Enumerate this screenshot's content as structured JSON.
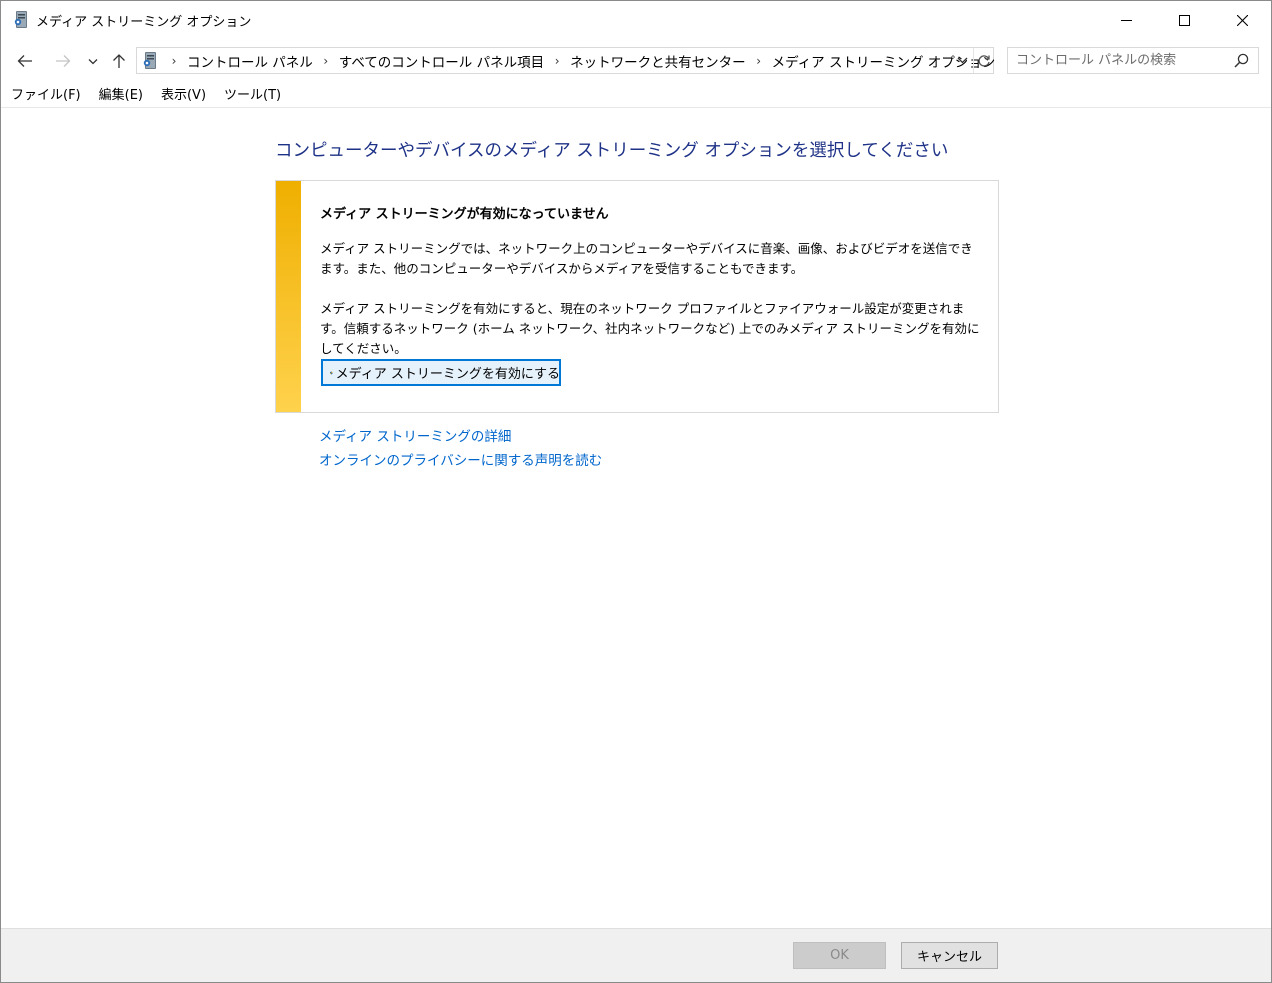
{
  "window": {
    "title": "メディア ストリーミング オプション"
  },
  "nav": {
    "breadcrumbs": [
      "コントロール パネル",
      "すべてのコントロール パネル項目",
      "ネットワークと共有センター",
      "メディア ストリーミング オプション"
    ],
    "search_placeholder": "コントロール パネルの検索"
  },
  "menu": {
    "items": [
      "ファイル(F)",
      "編集(E)",
      "表示(V)",
      "ツール(T)"
    ]
  },
  "main": {
    "title": "コンピューターやデバイスのメディア ストリーミング オプションを選択してください",
    "panel": {
      "heading": "メディア ストリーミングが有効になっていません",
      "p1": "メディア ストリーミングでは、ネットワーク上のコンピューターやデバイスに音楽、画像、およびビデオを送信できます。また、他のコンピューターやデバイスからメディアを受信することもできます。",
      "p2": "メディア ストリーミングを有効にすると、現在のネットワーク プロファイルとファイアウォール設定が変更されます。信頼するネットワーク (ホーム ネットワーク、社内ネットワークなど) 上でのみメディア ストリーミングを有効にしてください。",
      "enable_button": "メディア ストリーミングを有効にする"
    },
    "links": [
      "メディア ストリーミングの詳細",
      "オンラインのプライバシーに関する声明を読む"
    ]
  },
  "footer": {
    "ok_label": "OK",
    "cancel_label": "キャンセル"
  },
  "colors": {
    "title_blue": "#1e3287",
    "link_blue": "#0066cc",
    "stripe_top": "#efaf00",
    "stripe_bottom": "#ffd24d"
  },
  "icons": [
    "media-server-icon",
    "minimize-icon",
    "maximize-icon",
    "close-icon",
    "back-arrow-icon",
    "forward-arrow-icon",
    "recent-locations-icon",
    "up-arrow-icon",
    "chevron-right-icon",
    "chevron-down-icon",
    "refresh-icon",
    "search-icon",
    "uac-shield-icon"
  ]
}
